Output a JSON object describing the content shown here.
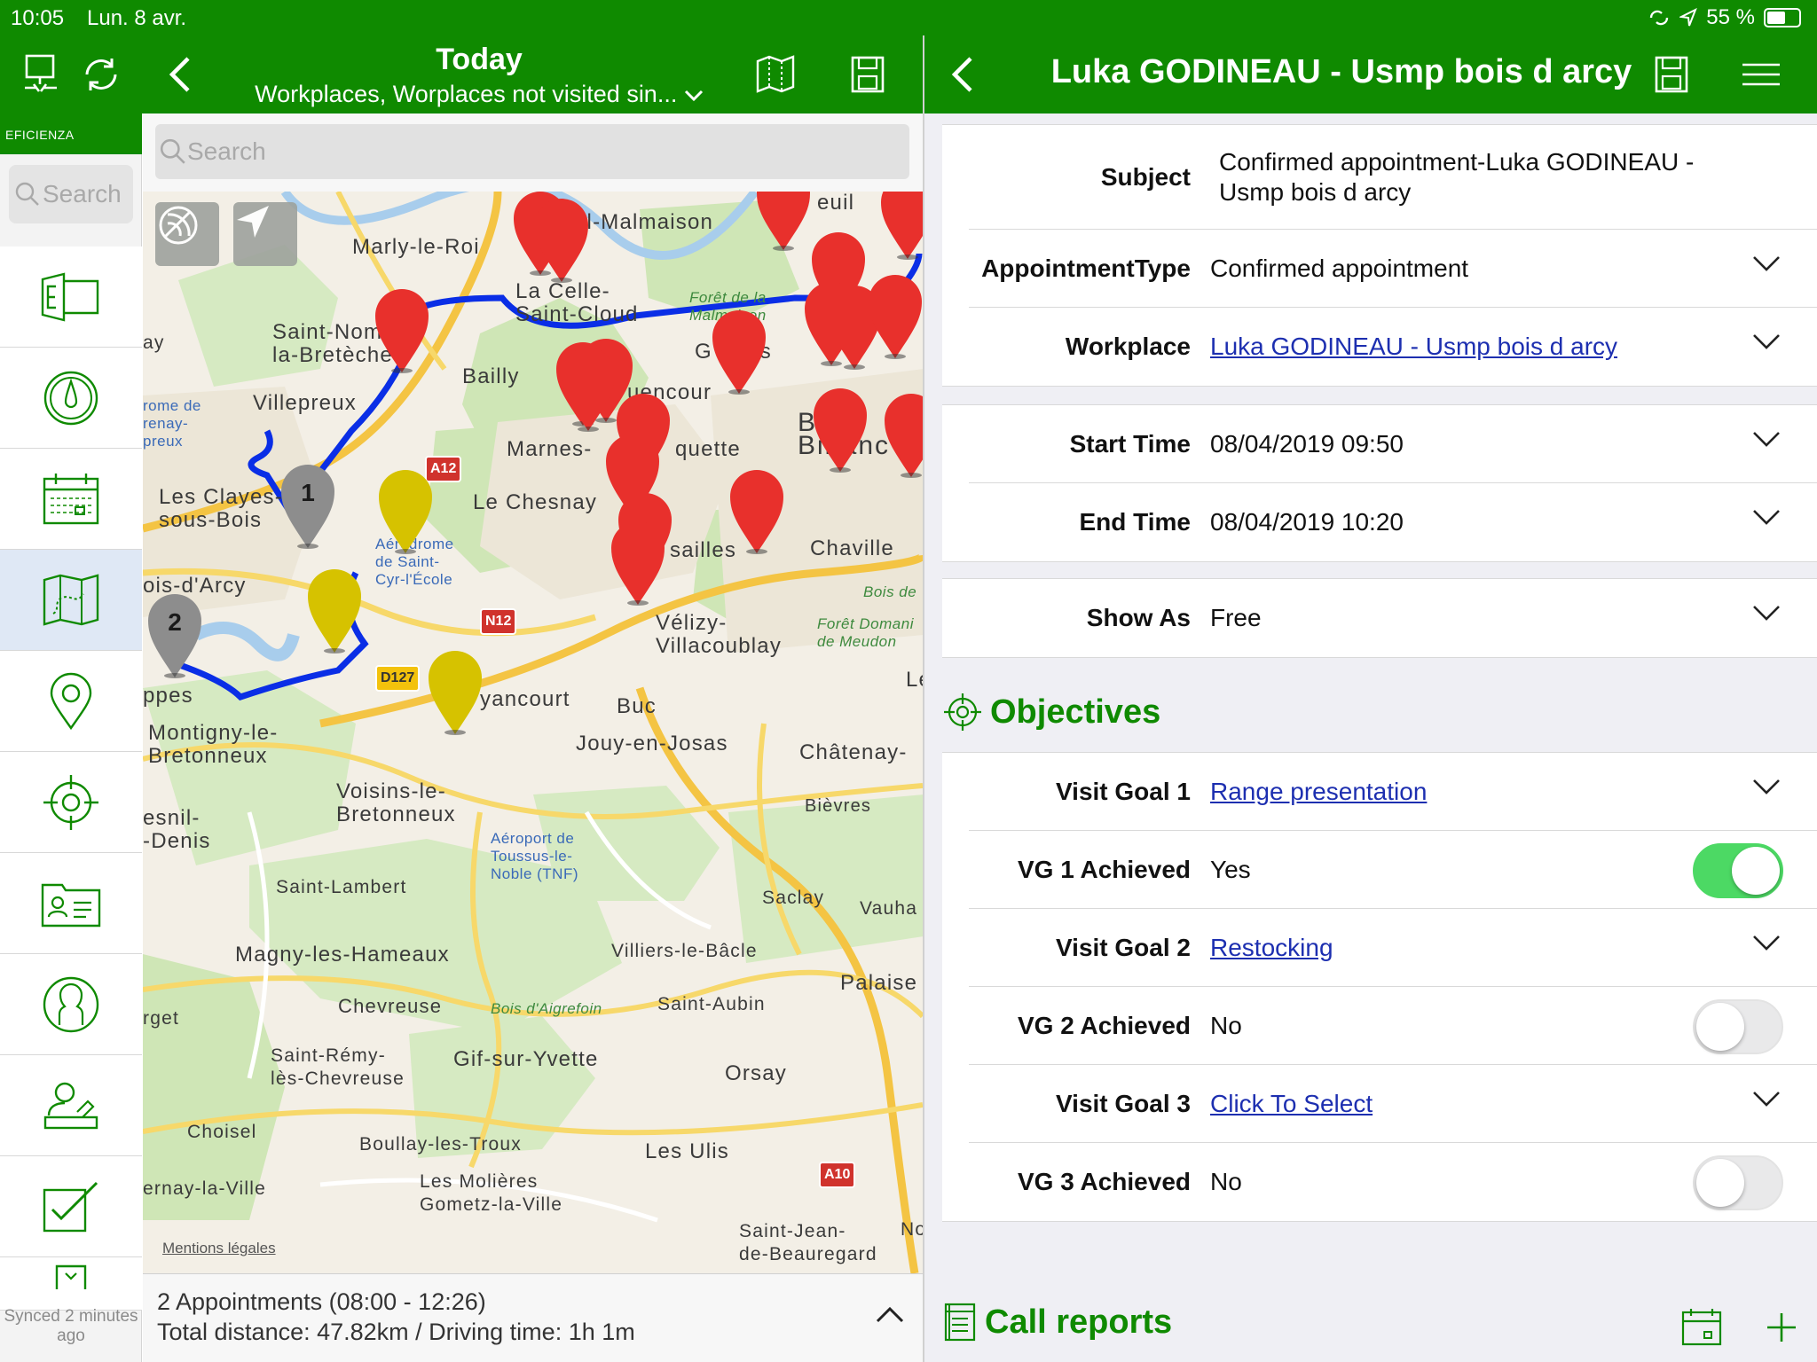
{
  "status": {
    "time": "10:05",
    "date": "Lun. 8 avr.",
    "battery": "55 %"
  },
  "left_nav": {
    "title": "Today",
    "subtitle": "Workplaces, Worplaces not visited sin..."
  },
  "right_nav": {
    "title": "Luka GODINEAU - Usmp bois d arcy"
  },
  "sidebar": {
    "brand": "EFICIENZA",
    "search_placeholder": "Search",
    "items": [
      {
        "icon": "exchange-icon"
      },
      {
        "icon": "dashboard-icon"
      },
      {
        "icon": "calendar-icon"
      },
      {
        "icon": "route-map-icon",
        "active": true
      },
      {
        "icon": "location-pin-icon"
      },
      {
        "icon": "target-icon"
      },
      {
        "icon": "contact-card-icon"
      },
      {
        "icon": "person-icon"
      },
      {
        "icon": "user-desk-icon"
      },
      {
        "icon": "checklist-icon"
      },
      {
        "icon": "report-icon"
      }
    ],
    "sync_text": "Synced 2 minutes ago"
  },
  "map": {
    "search_placeholder": "Search",
    "legal": "Mentions légales",
    "labels": [
      {
        "text": "Marly-le-Roi",
        "style": ""
      },
      {
        "text": "il-Malmaison",
        "style": ""
      },
      {
        "text": "La Celle-\nSaint-Cloud",
        "style": ""
      },
      {
        "text": "Saint-Nom-\nla-Bretèche",
        "style": ""
      },
      {
        "text": "Bailly",
        "style": ""
      },
      {
        "text": "Villepreux",
        "style": ""
      },
      {
        "text": "Marnes-",
        "style": ""
      },
      {
        "text": "quette",
        "style": ""
      },
      {
        "text": "Les Clayes-\nsous-Bois",
        "style": ""
      },
      {
        "text": "Le Chesnay",
        "style": ""
      },
      {
        "text": "sailles",
        "style": ""
      },
      {
        "text": "Chaville",
        "style": ""
      },
      {
        "text": "ois-d'Arcy",
        "style": ""
      },
      {
        "text": "Vélizy-\nVillacoublay",
        "style": ""
      },
      {
        "text": "ppes",
        "style": ""
      },
      {
        "text": "yancourt",
        "style": ""
      },
      {
        "text": "Buc",
        "style": ""
      },
      {
        "text": "Montigny-le-\nBretonneux",
        "style": ""
      },
      {
        "text": "Jouy-en-Josas",
        "style": ""
      },
      {
        "text": "Châtenay-",
        "style": ""
      },
      {
        "text": "Voisins-le-\nBretonneux",
        "style": ""
      },
      {
        "text": "esnil-\n-Denis",
        "style": ""
      },
      {
        "text": "Bièvres",
        "style": ""
      },
      {
        "text": "Saint-Lambert",
        "style": ""
      },
      {
        "text": "Saclay",
        "style": ""
      },
      {
        "text": "Vauha",
        "style": ""
      },
      {
        "text": "Magny-les-Hameaux",
        "style": ""
      },
      {
        "text": "Villiers-le-Bâcle",
        "style": ""
      },
      {
        "text": "Palaise",
        "style": ""
      },
      {
        "text": "Chevreuse",
        "style": ""
      },
      {
        "text": "Saint-Aubin",
        "style": ""
      },
      {
        "text": "rget",
        "style": ""
      },
      {
        "text": "Saint-Rémy-\nlès-Chevreuse",
        "style": ""
      },
      {
        "text": "Gif-sur-Yvette",
        "style": ""
      },
      {
        "text": "Orsay",
        "style": ""
      },
      {
        "text": "Choisel",
        "style": ""
      },
      {
        "text": "Boullay-les-Troux",
        "style": ""
      },
      {
        "text": "Les Ulis",
        "style": ""
      },
      {
        "text": "Les Molières\nGometz-la-Ville",
        "style": ""
      },
      {
        "text": "ernay-la-Ville",
        "style": ""
      },
      {
        "text": "Saint-Jean-\nde-Beauregard",
        "style": ""
      },
      {
        "text": "No",
        "style": ""
      },
      {
        "text": "Le",
        "style": ""
      },
      {
        "text": "ay",
        "style": ""
      },
      {
        "text": "Bois d'Aigrefoin",
        "style": "small-green"
      },
      {
        "text": "Forêt de la\nMalmaison",
        "style": "small-green"
      },
      {
        "text": "Bois de",
        "style": "small-green"
      },
      {
        "text": "Forêt Domani\nde Meudon",
        "style": "small-green"
      },
      {
        "text": "Aérodrome\nde Saint-\nCyr-l'École",
        "style": "blue"
      },
      {
        "text": "Aéroport de\nToussus-le-\nNoble (TNF)",
        "style": "blue"
      },
      {
        "text": "rome de\nrenay-\npreux",
        "style": "blue"
      },
      {
        "text": "B\nBil anc",
        "style": "big"
      },
      {
        "text": "G     es",
        "style": ""
      },
      {
        "text": "uencour",
        "style": ""
      },
      {
        "text": "euil",
        "style": ""
      }
    ],
    "shields": [
      {
        "text": "A12",
        "kind": "red"
      },
      {
        "text": "N12",
        "kind": "red"
      },
      {
        "text": "D127",
        "kind": "yellow"
      },
      {
        "text": "A10",
        "kind": "red"
      }
    ],
    "numbered_pins": [
      "1",
      "2"
    ],
    "summary_line1": "2 Appointments (08:00 - 12:26)",
    "summary_line2": "Total distance: 47.82km / Driving time: 1h 1m",
    "colors": {
      "red_pin": "#e8302c",
      "yellow_pin": "#d6c200",
      "gray_pin": "#8d8d8d",
      "route": "#0a2ee6"
    }
  },
  "detail": {
    "subject": {
      "label": "Subject",
      "value": "Confirmed appointment-Luka GODINEAU - Usmp bois d arcy"
    },
    "appointment_type": {
      "label": "AppointmentType",
      "value": "Confirmed appointment"
    },
    "workplace": {
      "label": "Workplace",
      "value": "Luka GODINEAU - Usmp bois d arcy"
    },
    "start_time": {
      "label": "Start Time",
      "value": "08/04/2019 09:50"
    },
    "end_time": {
      "label": "End Time",
      "value": "08/04/2019 10:20"
    },
    "show_as": {
      "label": "Show As",
      "value": "Free"
    },
    "objectives_title": "Objectives",
    "visit_goal_1": {
      "label": "Visit Goal 1",
      "value": "Range presentation"
    },
    "vg1_achieved": {
      "label": "VG 1 Achieved",
      "value": "Yes",
      "on": true
    },
    "visit_goal_2": {
      "label": "Visit Goal 2",
      "value": "Restocking"
    },
    "vg2_achieved": {
      "label": "VG 2 Achieved",
      "value": "No",
      "on": false
    },
    "visit_goal_3": {
      "label": "Visit Goal 3",
      "value": "Click To Select"
    },
    "vg3_achieved": {
      "label": "VG 3 Achieved",
      "value": "No",
      "on": false
    },
    "call_reports_title": "Call reports"
  },
  "accent": "#0f8a00"
}
